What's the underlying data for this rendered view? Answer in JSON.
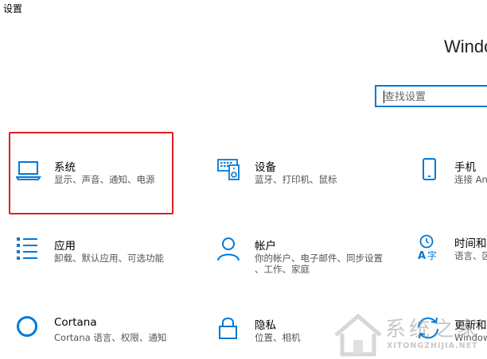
{
  "window": {
    "title": "设置"
  },
  "brand": {
    "text": "Windo"
  },
  "search": {
    "placeholder": "查找设置"
  },
  "tiles": [
    {
      "name": "系统",
      "desc": "显示、声音、通知、电源",
      "icon": "laptop-icon"
    },
    {
      "name": "设备",
      "desc": "蓝牙、打印机、鼠标",
      "icon": "devices-icon"
    },
    {
      "name": "手机",
      "desc": "连接 An",
      "icon": "phone-icon"
    },
    {
      "name": "应用",
      "desc": "卸载、默认应用、可选功能",
      "icon": "apps-list-icon"
    },
    {
      "name": "帐户",
      "desc": "你的帐户、电子邮件、同步设置、工作、家庭",
      "desc_line1": "你的帐户、电子邮件、同步设置",
      "desc_line2": "、工作、家庭",
      "icon": "person-icon"
    },
    {
      "name": "时间和",
      "desc": "语言、区",
      "icon": "time-language-icon"
    },
    {
      "name": "Cortana",
      "desc": "Cortana 语言、权限、通知",
      "icon": "cortana-circle-icon"
    },
    {
      "name": "隐私",
      "desc": "位置、相机",
      "icon": "lock-icon"
    },
    {
      "name": "更新和",
      "desc": "Window",
      "icon": "update-sync-icon"
    }
  ],
  "watermark": {
    "cn": "系统之家",
    "en": "XITONGZHIJIA.NET"
  },
  "colors": {
    "accent": "#0078d7",
    "highlight": "#e02020",
    "text": "#000000",
    "subtext": "#555555"
  }
}
